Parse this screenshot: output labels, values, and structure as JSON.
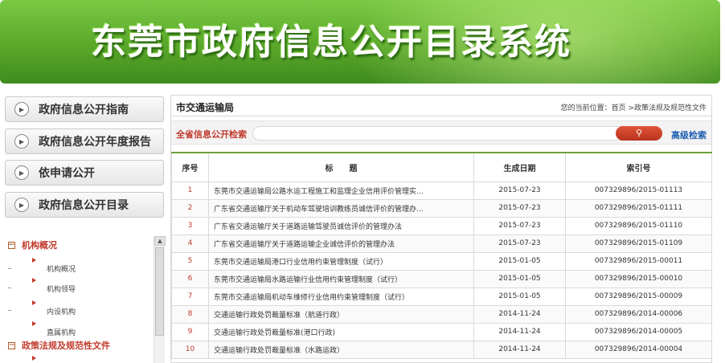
{
  "banner": {
    "title": "东莞市政府信息公开目录系统"
  },
  "nav": [
    {
      "label": "政府信息公开指南"
    },
    {
      "label": "政府信息公开年度报告"
    },
    {
      "label": "依申请公开"
    },
    {
      "label": "政府信息公开目录"
    }
  ],
  "tree": {
    "group1": "机构概况",
    "items": [
      "机构概况",
      "机构领导",
      "内设机构",
      "直属机构"
    ],
    "group2": "政策法规及规范性文件"
  },
  "panel": {
    "department": "市交通运输局",
    "location": "您的当前位置：首页 >政策法规及规范性文件"
  },
  "search": {
    "label": "全省信息公开检索",
    "button_icon": "search-icon",
    "advanced": "高级检索"
  },
  "table": {
    "headers": [
      "序号",
      "标　　题",
      "生成日期",
      "索引号"
    ],
    "rows": [
      {
        "no": "1",
        "title": "东莞市交通运输局公路水运工程施工和监理企业信用评价管理实...",
        "date": "2015-07-23",
        "index": "007329896/2015-01113"
      },
      {
        "no": "2",
        "title": "广东省交通运输厅关于机动车驾驶培训教练员诚信评价的管理办...",
        "date": "2015-07-23",
        "index": "007329896/2015-01111"
      },
      {
        "no": "3",
        "title": "广东省交通运输厅关于道路运输驾驶员诚信评价的管理办法",
        "date": "2015-07-23",
        "index": "007329896/2015-01110"
      },
      {
        "no": "4",
        "title": "广东省交通运输厅关于道路运输企业诚信评价的管理办法",
        "date": "2015-07-23",
        "index": "007329896/2015-01109"
      },
      {
        "no": "5",
        "title": "东莞市交通运输局港口行业信用约束管理制度（试行）",
        "date": "2015-01-05",
        "index": "007329896/2015-00011"
      },
      {
        "no": "6",
        "title": "东莞市交通运输局水路运输行业信用约束管理制度（试行）",
        "date": "2015-01-05",
        "index": "007329896/2015-00010"
      },
      {
        "no": "7",
        "title": "东莞市交通运输局机动车维修行业信用约束管理制度（试行）",
        "date": "2015-01-05",
        "index": "007329896/2015-00009"
      },
      {
        "no": "8",
        "title": "交通运输行政处罚裁量标准（航道行政）",
        "date": "2014-11-24",
        "index": "007329896/2014-00006"
      },
      {
        "no": "9",
        "title": "交通运输行政处罚裁量标准(港口行政)",
        "date": "2014-11-24",
        "index": "007329896/2014-00005"
      },
      {
        "no": "10",
        "title": "交通运输行政处罚裁量标准（水路运政）",
        "date": "2014-11-24",
        "index": "007329896/2014-00004"
      }
    ]
  },
  "colors": {
    "brand_green": "#5aa82a",
    "accent_red": "#c0392b",
    "link_blue": "#1f5fb0"
  }
}
